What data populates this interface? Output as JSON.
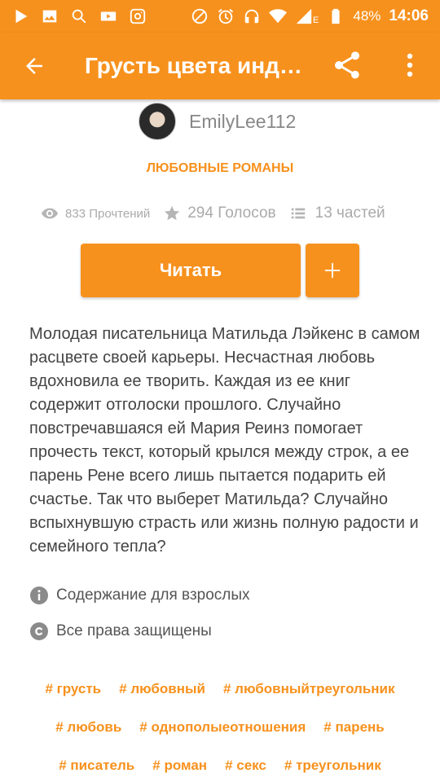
{
  "status_bar": {
    "battery": "48%",
    "time": "14:06",
    "network_badge": "E",
    "left_icons": [
      "play-store-icon",
      "gallery-icon",
      "search-icon",
      "youtube-icon",
      "instagram-icon"
    ],
    "right_icons": [
      "do-not-disturb-icon",
      "alarm-icon",
      "headphones-icon",
      "wifi-icon",
      "signal-icon",
      "battery-icon"
    ]
  },
  "app_bar": {
    "title": "Грусть цвета индиго",
    "color": "#F7911D"
  },
  "story": {
    "author": "EmilyLee112",
    "category": "ЛЮБОВНЫЕ РОМАНЫ",
    "reads": "833 Прочтений",
    "votes": "294 Голосов",
    "parts": "13 частей",
    "read_button": "Читать",
    "description": "Молодая писательница Матильда Лэйкенс в самом расцвете своей карьеры. Несчастная любовь вдохновила ее творить. Каждая из ее книг содержит отголоски  прошлого. Случайно повстречавшаяся ей Мария Реинз помогает прочесть текст, который крылся между строк, а ее парень Рене всего лишь пытается подарить ей счастье. Так что выберет Матильда? Случайно вспыхнувшую страсть или жизнь полную радости и семейного тепла?",
    "mature": "Содержание для взрослых",
    "copyright": "Все права защищены"
  },
  "tags": [
    [
      "# грусть",
      "# любовный",
      "# любовныйтреугольник"
    ],
    [
      "# любовь",
      "# однополыеотношения",
      "# парень"
    ],
    [
      "# писатель",
      "# роман",
      "# секс",
      "# треугольник"
    ]
  ]
}
